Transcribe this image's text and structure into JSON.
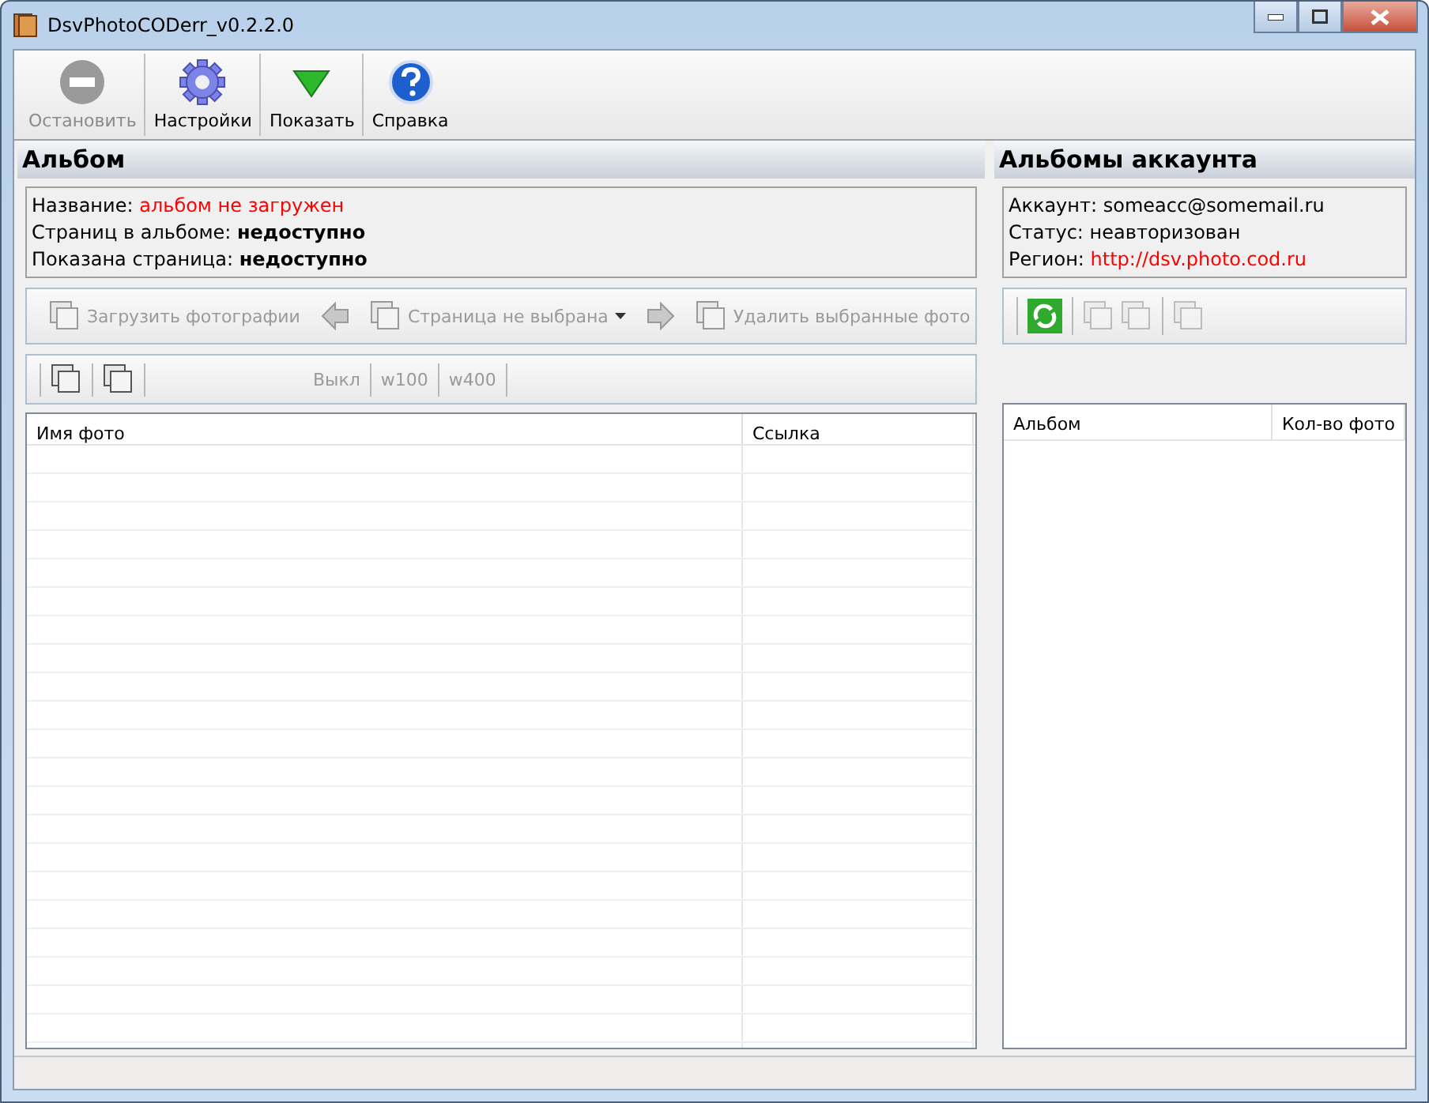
{
  "window": {
    "title": "DsvPhotoCODerr_v0.2.2.0"
  },
  "toolbar": [
    {
      "label": "Остановить",
      "kind": "stop",
      "disabled": true
    },
    {
      "label": "Настройки",
      "kind": "gear",
      "disabled": false
    },
    {
      "label": "Показать",
      "kind": "down",
      "disabled": false
    },
    {
      "label": "Справка",
      "kind": "help",
      "disabled": false
    }
  ],
  "album": {
    "title": "Альбом",
    "info": [
      {
        "label": "Название:",
        "value": "альбом не загружен",
        "kind": "alert"
      },
      {
        "label": "Страниц в альбоме:",
        "value": "недоступно",
        "kind": "bold"
      },
      {
        "label": "Показана страница:",
        "value": "недоступно",
        "kind": "bold"
      }
    ],
    "actions": [
      {
        "kind": "upload",
        "label": "Загрузить фотографии",
        "disabled": true
      },
      {
        "kind": "prev",
        "disabled": true
      },
      {
        "kind": "page",
        "label": "Страница не выбрана",
        "disabled": true
      },
      {
        "kind": "next",
        "disabled": true
      },
      {
        "kind": "delete",
        "label": "Удалить выбранные фото",
        "disabled": true
      }
    ],
    "view_tools": [
      {
        "kind": "stack"
      },
      {
        "kind": "check"
      },
      {
        "kind": "spacer"
      },
      {
        "kind": "text",
        "label": "Выкл"
      },
      {
        "kind": "text",
        "label": "w100"
      },
      {
        "kind": "text",
        "label": "w400"
      }
    ],
    "table": {
      "columns": [
        "Имя фото",
        "Ссылка"
      ]
    }
  },
  "account": {
    "title": "Альбомы аккаунта",
    "info": [
      {
        "label": "Аккаунт:",
        "value": "someacc@somemail.ru",
        "kind": "plain"
      },
      {
        "label": "Статус:",
        "value": "неавторизован",
        "kind": "plain"
      },
      {
        "label": "Регион:",
        "value": "http://dsv.photo.cod.ru",
        "kind": "alert"
      }
    ],
    "tools": [
      {
        "kind": "refresh",
        "disabled": false
      },
      {
        "kind": "back",
        "disabled": true
      },
      {
        "kind": "add",
        "disabled": true
      },
      {
        "kind": "delete",
        "disabled": true
      }
    ],
    "table": {
      "columns": [
        "Альбом",
        "Кол-во фото"
      ]
    }
  }
}
